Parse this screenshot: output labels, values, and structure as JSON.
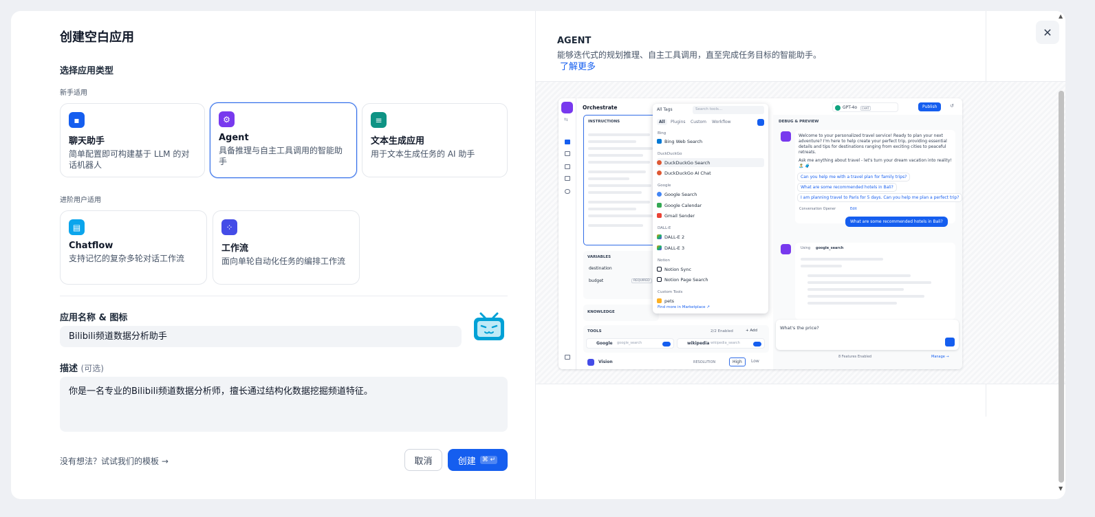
{
  "title": "创建空白应用",
  "section_type": "选择应用类型",
  "group_beginner": "新手适用",
  "group_advanced": "进阶用户适用",
  "cards": [
    {
      "title": "聊天助手",
      "desc": "简单配置即可构建基于 LLM 的对话机器人",
      "icon": "chat-icon",
      "color": "#155eef"
    },
    {
      "title": "Agent",
      "desc": "具备推理与自主工具调用的智能助手",
      "icon": "agent-icon",
      "color": "#7839ee"
    },
    {
      "title": "文本生成应用",
      "desc": "用于文本生成任务的 AI 助手",
      "icon": "text-gen-icon",
      "color": "#0e9384"
    },
    {
      "title": "Chatflow",
      "desc": "支持记忆的复杂多轮对话工作流",
      "icon": "chatflow-icon",
      "color": "#0ba5ec"
    },
    {
      "title": "工作流",
      "desc": "面向单轮自动化任务的编排工作流",
      "icon": "workflow-icon",
      "color": "#444ce7"
    }
  ],
  "name_label": "应用名称 & 图标",
  "name_value": "Bilibili频道数据分析助手",
  "desc_label": "描述",
  "desc_optional": "(可选)",
  "desc_value": "你是一名专业的Bilibili频道数据分析师，擅长通过结构化数据挖掘频道特征。",
  "hint": "没有想法？试试我们的模板 →",
  "cancel": "取消",
  "create": "创建",
  "create_kbd": "⌘ ↵",
  "preview": {
    "title": "AGENT",
    "desc": "能够迭代式的规划推理、自主工具调用，直至完成任务目标的智能助手。",
    "link": "了解更多",
    "orchestrate": "Orchestrate",
    "instructions": "INSTRUCTIONS",
    "variables": "VARIABLES",
    "var1": "destination",
    "var2": "budget",
    "required": "REQUIRED",
    "knowledge": "KNOWLEDGE",
    "tools": "TOOLS",
    "tools_enabled": "2/2 Enabled",
    "add": "+ Add",
    "tool1": "Google",
    "tool1_sub": "google_search",
    "tool2": "wikipedia",
    "tool2_sub": "wikipedia_search",
    "vision": "Vision",
    "resolution": "RESOLUTION",
    "high": "High",
    "low": "Low",
    "all_tags": "All Tags",
    "search_tools": "Search tools...",
    "tabs": [
      "All",
      "Plugins",
      "Custom",
      "Workflow"
    ],
    "groups": [
      {
        "name": "Bing",
        "items": [
          "Bing Web Search"
        ]
      },
      {
        "name": "DuckDuckGo",
        "items": [
          "DuckDuckGo Search",
          "DuckDuckGo AI Chat"
        ]
      },
      {
        "name": "Google",
        "items": [
          "Google Search",
          "Google Calendar",
          "Gmail Sender"
        ]
      },
      {
        "name": "DALL-E",
        "items": [
          "DALL-E 2",
          "DALL-E 3"
        ]
      },
      {
        "name": "Notion",
        "items": [
          "Notion Sync",
          "Notion Page Search"
        ]
      },
      {
        "name": "Custom Tools",
        "items": [
          "pets"
        ]
      }
    ],
    "find_more": "Find more in",
    "marketplace": "Marketplace ↗",
    "model": "GPT-4o",
    "chat_badge": "CHAT",
    "publish": "Publish",
    "debug": "DEBUG & PREVIEW",
    "welcome": "Welcome to your personalized travel service! Ready to plan your next adventure? I'm here to help create your perfect trip, providing essential details and tips for destinations ranging from exciting cities to peaceful retreats.",
    "ask": "Ask me anything about travel - let's turn your dream vacation into reality! 🏝️ 🧳",
    "suggestions": [
      "Can you help me with a travel plan for family trips?",
      "What are some recommended hotels in Bali?",
      "I am planning travel to Paris for 5 days. Can you help me plan a perfect trip?"
    ],
    "opener": "Conversation Opener",
    "edit": "Edit",
    "user_msg": "What are some recommended hotels in Bali?",
    "using": "Using",
    "using_tool": "google_search",
    "input_text": "What's the price?",
    "features": "8 Features Enabled",
    "manage": "Manage →"
  }
}
